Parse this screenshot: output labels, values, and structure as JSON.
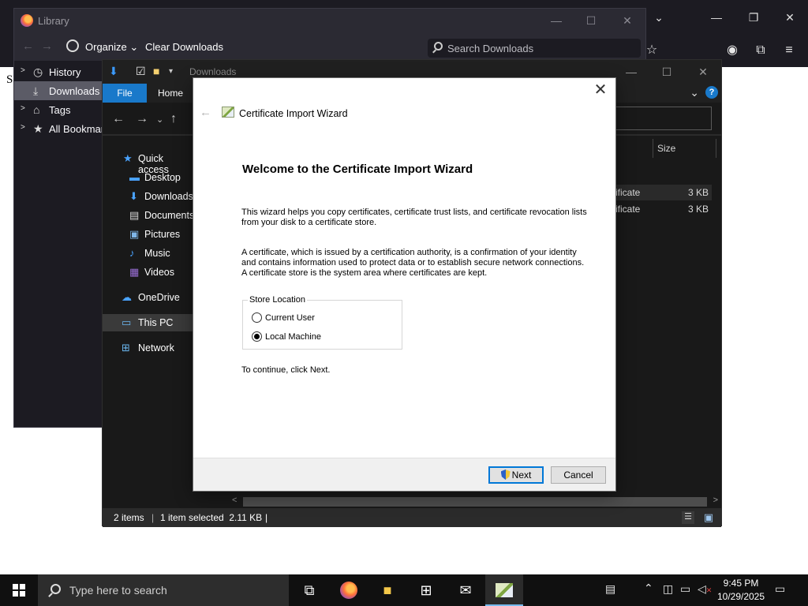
{
  "browser": {
    "page_char": "S",
    "caption_buttons": [
      "—",
      "❐",
      "✕"
    ],
    "dropdown_glyph": "⌄",
    "toolbar_icons": [
      "star-icon",
      "account-icon",
      "extensions-icon",
      "menu-icon"
    ]
  },
  "library": {
    "title": "Library",
    "organize_label": "Organize",
    "clear_label": "Clear Downloads",
    "search_placeholder": "Search Downloads",
    "sidebar": [
      {
        "label": "History",
        "icon": "clock-icon",
        "twisty": true,
        "selected": false
      },
      {
        "label": "Downloads",
        "icon": "download-icon",
        "twisty": false,
        "selected": true
      },
      {
        "label": "Tags",
        "icon": "tag-icon",
        "twisty": true,
        "selected": false
      },
      {
        "label": "All Bookmarks",
        "icon": "star-icon",
        "twisty": true,
        "selected": false
      }
    ]
  },
  "explorer": {
    "title": "Downloads",
    "tabs": {
      "file": "File",
      "home": "Home"
    },
    "nav": [
      {
        "label": "Quick access",
        "icon": "star-icon",
        "color": "#4aa3ff",
        "indent": 1,
        "selected": false
      },
      {
        "label": "Desktop",
        "icon": "desktop-icon",
        "color": "#4aa3ff",
        "indent": 2,
        "selected": false
      },
      {
        "label": "Downloads",
        "icon": "download-icon",
        "color": "#4aa3ff",
        "indent": 2,
        "selected": false
      },
      {
        "label": "Documents",
        "icon": "document-icon",
        "color": "#d8d8d8",
        "indent": 2,
        "selected": false
      },
      {
        "label": "Pictures",
        "icon": "picture-icon",
        "color": "#7fb6e8",
        "indent": 2,
        "selected": false
      },
      {
        "label": "Music",
        "icon": "music-icon",
        "color": "#4aa3ff",
        "indent": 2,
        "selected": false
      },
      {
        "label": "Videos",
        "icon": "video-icon",
        "color": "#9a6fd6",
        "indent": 2,
        "selected": false
      },
      {
        "label": "OneDrive",
        "icon": "cloud-icon",
        "color": "#4aa3ff",
        "indent": 1,
        "selected": false
      },
      {
        "label": "This PC",
        "icon": "computer-icon",
        "color": "#6cb7f0",
        "indent": 1,
        "selected": true
      },
      {
        "label": "Network",
        "icon": "network-icon",
        "color": "#6cb7f0",
        "indent": 1,
        "selected": false
      }
    ],
    "column_size": "Size",
    "files": [
      {
        "name": "ificate",
        "size": "3 KB"
      },
      {
        "name": "ificate",
        "size": "3 KB"
      }
    ],
    "status": {
      "items": "2 items",
      "selected": "1 item selected  2.11 KB"
    }
  },
  "wizard": {
    "header": "Certificate Import Wizard",
    "heading": "Welcome to the Certificate Import Wizard",
    "para1": "This wizard helps you copy certificates, certificate trust lists, and certificate revocation lists from your disk to a certificate store.",
    "para2": "A certificate, which is issued by a certification authority, is a confirmation of your identity and contains information used to protect data or to establish secure network connections. A certificate store is the system area where certificates are kept.",
    "store_location_label": "Store Location",
    "options": [
      {
        "label": "Current User",
        "checked": false
      },
      {
        "label": "Local Machine",
        "checked": true
      }
    ],
    "continue_text": "To continue, click Next.",
    "next_label": "Next",
    "cancel_label": "Cancel"
  },
  "taskbar": {
    "search_placeholder": "Type here to search",
    "apps": [
      "task-view-icon",
      "firefox-icon",
      "file-explorer-icon",
      "store-icon",
      "mail-icon",
      "certificate-wizard-icon"
    ],
    "time": "9:45 PM",
    "date": "10/29/2025"
  },
  "colors": {
    "accent": "#0078d7",
    "explorer_file_tab": "#1979ca",
    "firefox_dark": "#1c1b22"
  }
}
